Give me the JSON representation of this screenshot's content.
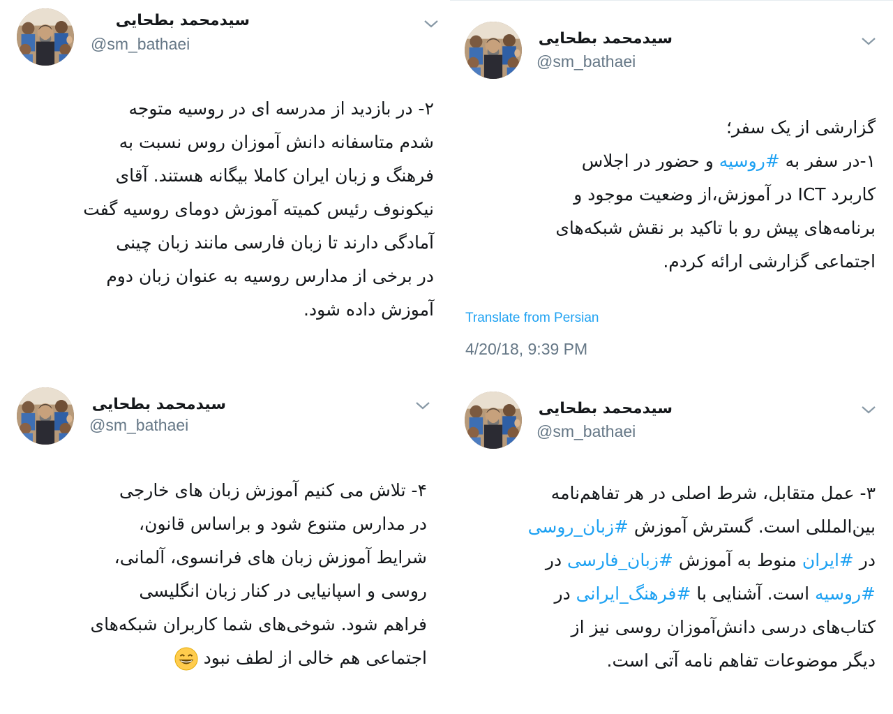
{
  "author": {
    "display_name": "سیدمحمد بطحایی",
    "handle": "@sm_bathaei"
  },
  "tweets": [
    {
      "id": "tweet-1",
      "lines": [
        [
          {
            "t": "گزارشی از یک سفر؛"
          }
        ],
        [
          {
            "t": "۱-در سفر به "
          },
          {
            "t": "#روسیه",
            "tag": true
          },
          {
            "t": " و حضور در اجلاس"
          }
        ],
        [
          {
            "t": "کاربرد ICT در آموزش،از وضعیت موجود و"
          }
        ],
        [
          {
            "t": "برنامه‌های پیش رو با تاکید بر نقش شبکه‌های"
          }
        ],
        [
          {
            "t": "اجتماعی گزارشی ارائه کردم."
          }
        ]
      ],
      "translate_label": "Translate from Persian",
      "timestamp": "4/20/18, 9:39 PM"
    },
    {
      "id": "tweet-2",
      "lines": [
        [
          {
            "t": "۲- در بازدید از مدرسه ای در روسیه متوجه"
          }
        ],
        [
          {
            "t": "شدم متاسفانه دانش آموزان روس نسبت به"
          }
        ],
        [
          {
            "t": "فرهنگ و زبان ایران کاملا بیگانه هستند. آقای"
          }
        ],
        [
          {
            "t": "نیکونوف رئیس کمیته آموزش دومای روسیه گفت"
          }
        ],
        [
          {
            "t": "آمادگی دارند تا زبان فارسی مانند زبان چینی"
          }
        ],
        [
          {
            "t": "در برخی از مدارس روسیه به عنوان زبان دوم"
          }
        ],
        [
          {
            "t": "آموزش داده شود."
          }
        ]
      ]
    },
    {
      "id": "tweet-3",
      "lines": [
        [
          {
            "t": "۳- عمل متقابل، شرط اصلی در هر تفاهم‌نامه"
          }
        ],
        [
          {
            "t": "بین‌المللی است. گسترش آموزش "
          },
          {
            "t": "#زبان_روسی",
            "tag": true
          }
        ],
        [
          {
            "t": "در "
          },
          {
            "t": "#ایران",
            "tag": true
          },
          {
            "t": " منوط به آموزش "
          },
          {
            "t": "#زبان_فارسی",
            "tag": true
          },
          {
            "t": " در"
          }
        ],
        [
          {
            "t": "#روسیه",
            "tag": true
          },
          {
            "t": " است. آشنایی با "
          },
          {
            "t": "#فرهنگ_ایرانی",
            "tag": true
          },
          {
            "t": " در"
          }
        ],
        [
          {
            "t": "کتاب‌های درسی دانش‌آموزان روسی نیز از"
          }
        ],
        [
          {
            "t": "دیگر موضوعات تفاهم نامه آتی است."
          }
        ]
      ]
    },
    {
      "id": "tweet-4",
      "lines": [
        [
          {
            "t": "۴- تلاش می کنیم آموزش زبان های خارجی"
          }
        ],
        [
          {
            "t": "در مدارس متنوع شود و براساس قانون،"
          }
        ],
        [
          {
            "t": "شرایط آموزش زبان های فرانسوی، آلمانی،"
          }
        ],
        [
          {
            "t": "روسی و اسپانیایی در کنار زبان انگلیسی"
          }
        ],
        [
          {
            "t": "فراهم شود. شوخی‌های شما کاربران شبکه‌های"
          }
        ],
        [
          {
            "t": "اجتماعی هم خالی از لطف نبود"
          },
          {
            "emoji": "grinning-face-emoji"
          }
        ]
      ]
    }
  ],
  "icons": {
    "avatar": "group-photo-avatar",
    "menu": "chevron-down-icon",
    "emoji": "grinning-face-emoji"
  },
  "colors": {
    "hashtag": "#1da1f2",
    "muted": "#657786",
    "text": "#14171a"
  }
}
